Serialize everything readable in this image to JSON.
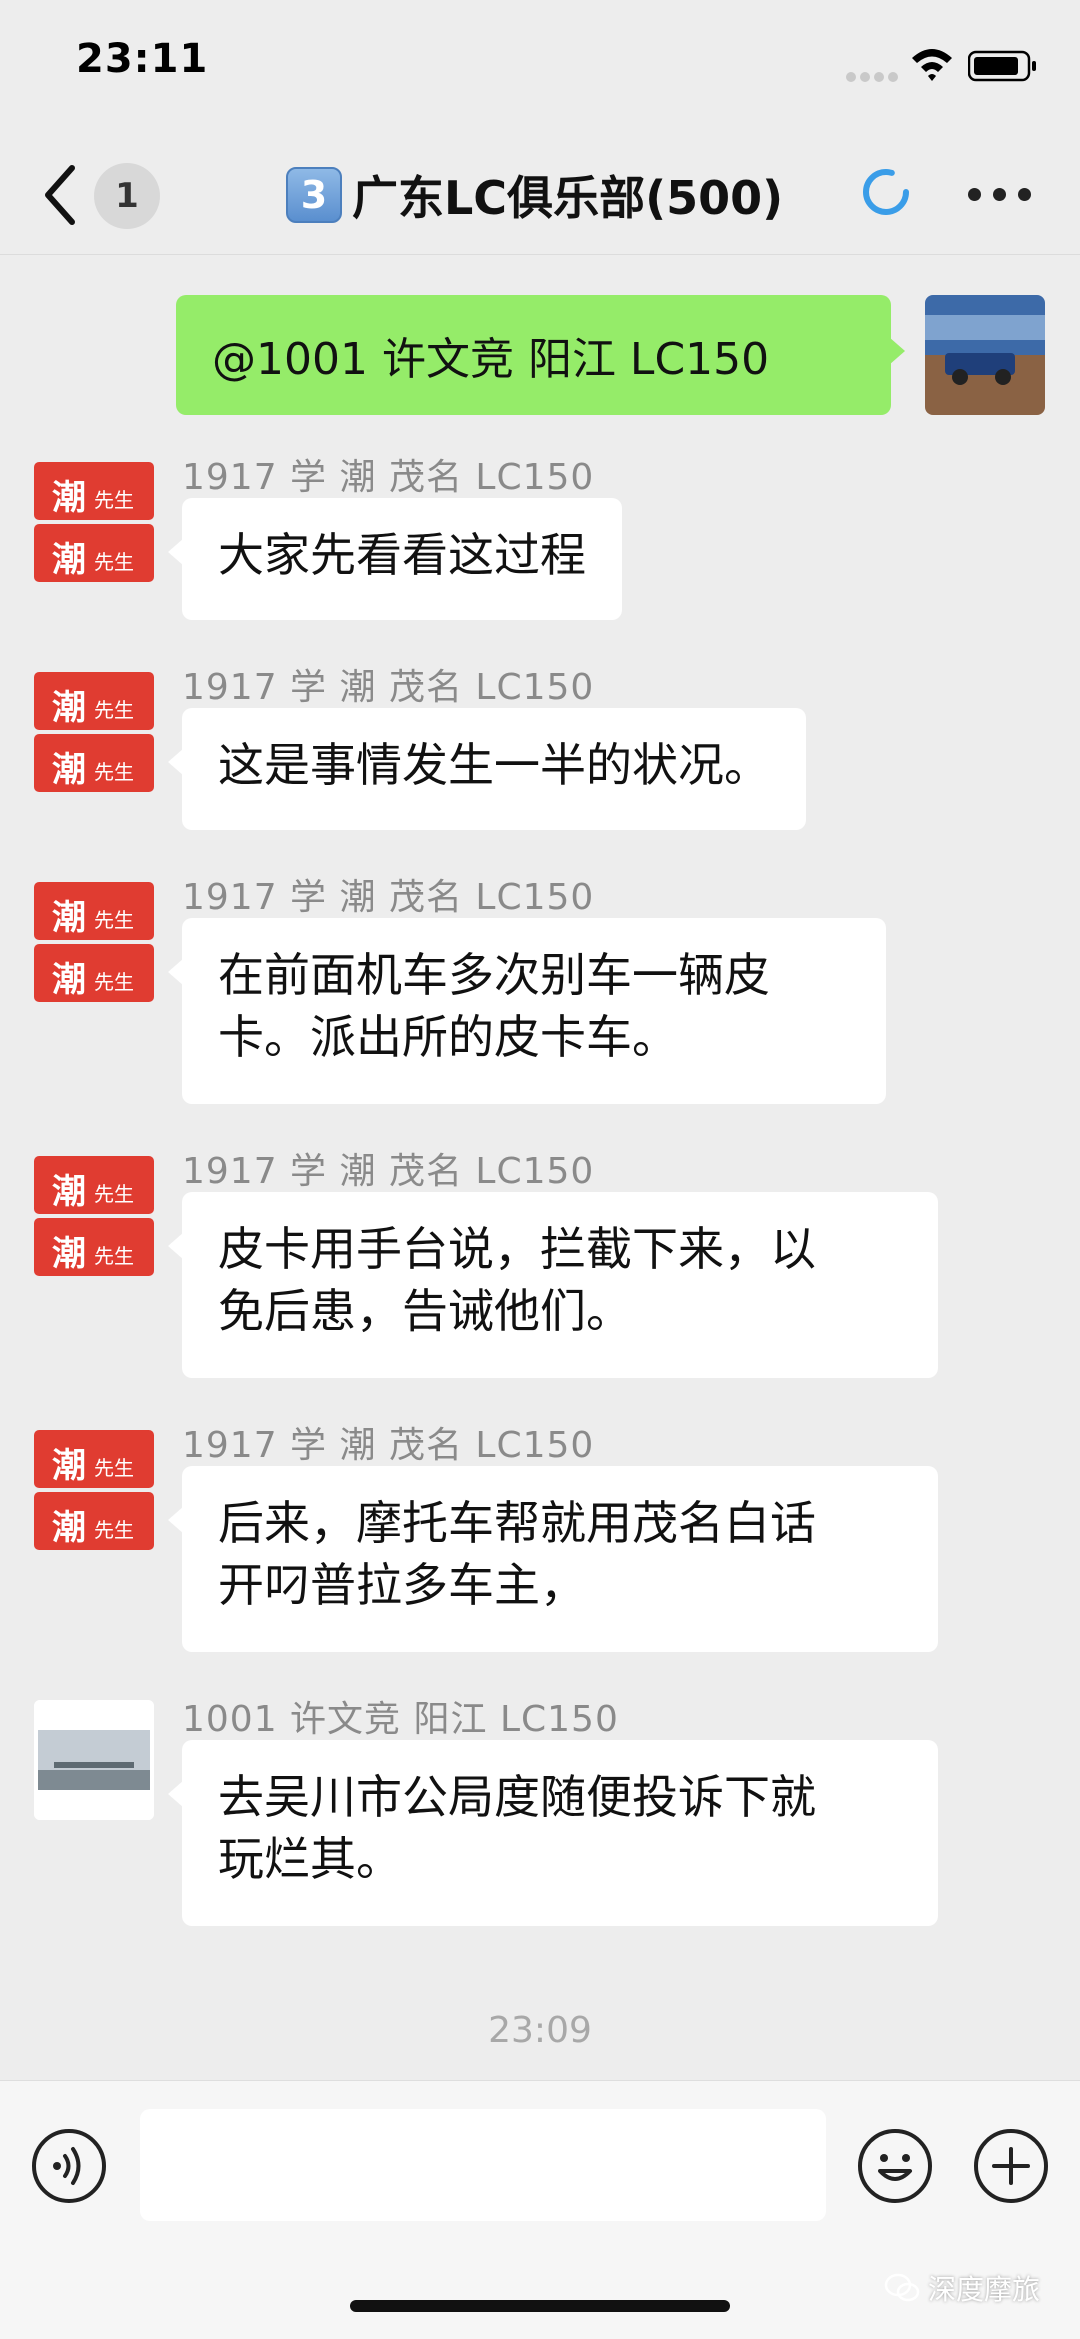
{
  "status_bar": {
    "time": "23:11"
  },
  "nav": {
    "unread_count": "1",
    "group_badge": "3",
    "title": "广东LC俱乐部(500)"
  },
  "outgoing": {
    "text": "@1001 许文竞 阳江  LC150"
  },
  "messages": [
    {
      "sender": "1917 学 潮 茂名  LC150",
      "text": "大家先看看这过程",
      "avatar": "chao"
    },
    {
      "sender": "1917 学 潮 茂名  LC150",
      "text": "这是事情发生一半的状况。",
      "avatar": "chao"
    },
    {
      "sender": "1917 学 潮 茂名  LC150",
      "text": "在前面机车多次别车一辆皮\n卡。派出所的皮卡车。",
      "avatar": "chao"
    },
    {
      "sender": "1917 学 潮 茂名  LC150",
      "text": "皮卡用手台说，拦截下来，以\n免后患，告诫他们。",
      "avatar": "chao"
    },
    {
      "sender": "1917 学 潮 茂名  LC150",
      "text": "后来，摩托车帮就用茂名白话\n开叼普拉多车主，",
      "avatar": "chao"
    },
    {
      "sender": "1001 许文竞 阳江  LC150",
      "text": "去吴川市公局度随便投诉下就\n玩烂其。",
      "avatar": "photo"
    }
  ],
  "avatar_label": {
    "big": "潮",
    "small": "先生"
  },
  "time_divider": "23:09",
  "input": {
    "placeholder": ""
  },
  "watermark": "深度摩旅",
  "colors": {
    "outgoing_bubble": "#95ec69",
    "chao_red": "#e03c31"
  },
  "icons": [
    "back-icon",
    "sync-icon",
    "more-icon",
    "voice-icon",
    "emoji-icon",
    "plus-icon"
  ]
}
